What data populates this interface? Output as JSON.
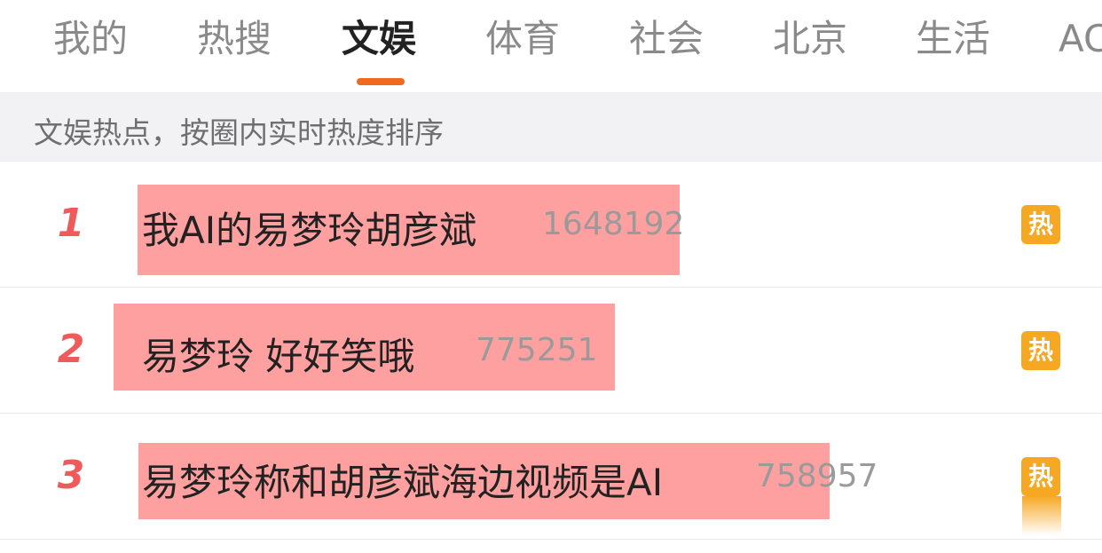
{
  "tabs": [
    {
      "label": "我的"
    },
    {
      "label": "热搜"
    },
    {
      "label": "文娱"
    },
    {
      "label": "体育"
    },
    {
      "label": "社会"
    },
    {
      "label": "北京"
    },
    {
      "label": "生活"
    },
    {
      "label": "AC"
    }
  ],
  "active_tab": "文娱",
  "info": {
    "text": "文娱热点，按圈内实时热度排序"
  },
  "list": [
    {
      "rank": "1",
      "title": "我AI的易梦玲胡彦斌",
      "count": "1648192",
      "badge": "热"
    },
    {
      "rank": "2",
      "title": "易梦玲 好好笑哦",
      "count": "775251",
      "badge": "热"
    },
    {
      "rank": "3",
      "title": "易梦玲称和胡彦斌海边视频是AI",
      "count": "758957",
      "badge": "热"
    }
  ],
  "colors": {
    "accent": "#ef6a1f",
    "rank": "#ef5b5b",
    "highlight": "#ff9b9b",
    "badge": "#f6a823"
  }
}
